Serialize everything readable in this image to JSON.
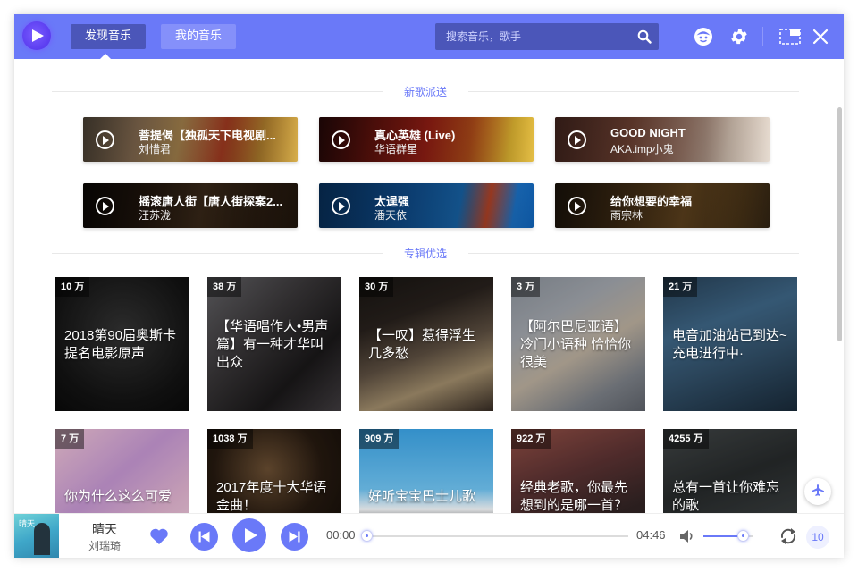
{
  "header": {
    "tabs": [
      {
        "label": "发现音乐",
        "active": true
      },
      {
        "label": "我的音乐",
        "active": false
      }
    ],
    "search_placeholder": "搜索音乐，歌手",
    "accent_color": "#6a79f8"
  },
  "sections": {
    "new_songs_title": "新歌派送",
    "albums_title": "专辑优选"
  },
  "new_songs": [
    {
      "name": "菩提偈【独孤天下电视剧...",
      "artist": "刘惜君"
    },
    {
      "name": "真心英雄 (Live)",
      "artist": "华语群星"
    },
    {
      "name": "GOOD NIGHT",
      "artist": "AKA.imp小鬼"
    },
    {
      "name": "摇滚唐人街【唐人街探案2...",
      "artist": "汪苏泷"
    },
    {
      "name": "太逞强",
      "artist": "潘天依"
    },
    {
      "name": "给你想要的幸福",
      "artist": "雨宗林"
    }
  ],
  "albums": [
    {
      "count": "10 万",
      "title": "2018第90届奥斯卡提名电影原声"
    },
    {
      "count": "38 万",
      "title": "【华语唱作人•男声篇】有一种才华叫出众"
    },
    {
      "count": "30 万",
      "title": "【一叹】惹得浮生几多愁"
    },
    {
      "count": "3 万",
      "title": "【阿尔巴尼亚语】冷门小语种 恰恰你很美"
    },
    {
      "count": "21 万",
      "title": "电音加油站已到达~充电进行中·"
    },
    {
      "count": "7 万",
      "title": "你为什么这么可爱"
    },
    {
      "count": "1038 万",
      "title": "2017年度十大华语金曲！"
    },
    {
      "count": "909 万",
      "title": "好听宝宝巴士儿歌"
    },
    {
      "count": "922 万",
      "title": "经典老歌，你最先想到的是哪一首？"
    },
    {
      "count": "4255 万",
      "title": "总有一首让你难忘的歌"
    }
  ],
  "player": {
    "title": "晴天",
    "artist": "刘瑞琦",
    "current_time": "00:00",
    "duration": "04:46",
    "progress": 0,
    "volume": 0.8,
    "queue_count": "10",
    "cover_text": "晴天"
  }
}
